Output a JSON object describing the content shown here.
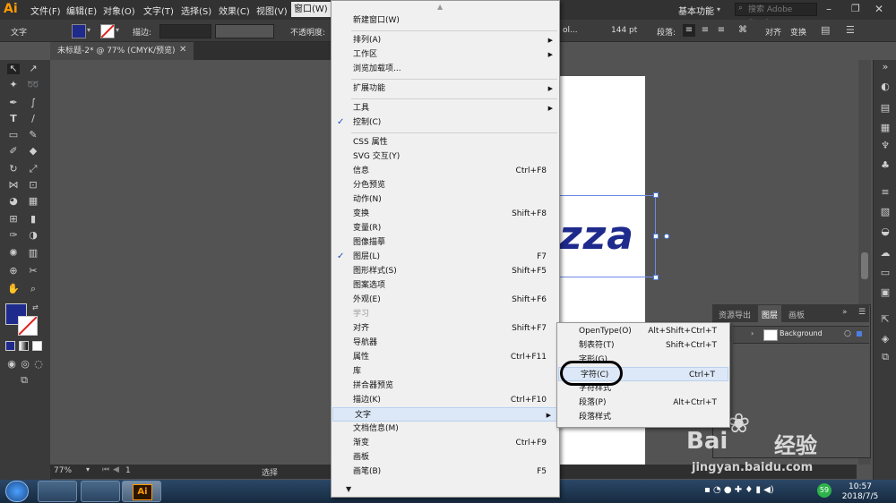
{
  "app": {
    "logo": "Ai"
  },
  "menubar": {
    "items": [
      "文件(F)",
      "编辑(E)",
      "对象(O)",
      "文字(T)",
      "选择(S)",
      "效果(C)",
      "视图(V)",
      "窗口(W)"
    ],
    "workspace": "基本功能",
    "search_placeholder": "搜索 Adobe Stock"
  },
  "controlbar": {
    "label": "文字",
    "stroke_label": "描边:",
    "opacity_label": "不透明度:",
    "font_fragment": "ol...",
    "font_size": "144 pt",
    "paragraph_label": "段落:",
    "align_label": "对齐",
    "transform_label": "变换"
  },
  "document": {
    "tab_title": "未标题-2* @ 77% (CMYK/预览)",
    "text": "zza"
  },
  "statusbar": {
    "zoom": "77%",
    "page": "1",
    "tool": "选择"
  },
  "layers_panel": {
    "tabs": [
      "资源导出",
      "图层",
      "画板"
    ],
    "layer_name": "Background"
  },
  "window_menu": {
    "items": [
      {
        "label": "新建窗口(W)"
      },
      {
        "sep": true
      },
      {
        "label": "排列(A)",
        "submenu": true
      },
      {
        "label": "工作区",
        "submenu": true
      },
      {
        "label": "浏览加载项..."
      },
      {
        "sep": true
      },
      {
        "label": "扩展功能",
        "submenu": true
      },
      {
        "sep": true
      },
      {
        "label": "工具",
        "submenu": true
      },
      {
        "label": "控制(C)",
        "checked": true
      },
      {
        "sep": true
      },
      {
        "label": "CSS 属性"
      },
      {
        "label": "SVG 交互(Y)"
      },
      {
        "label": "信息",
        "shortcut": "Ctrl+F8"
      },
      {
        "label": "分色预览"
      },
      {
        "label": "动作(N)"
      },
      {
        "label": "变换",
        "shortcut": "Shift+F8"
      },
      {
        "label": "变量(R)"
      },
      {
        "label": "图像描摹"
      },
      {
        "label": "图层(L)",
        "shortcut": "F7",
        "checked": true
      },
      {
        "label": "图形样式(S)",
        "shortcut": "Shift+F5"
      },
      {
        "label": "图案选项"
      },
      {
        "label": "外观(E)",
        "shortcut": "Shift+F6"
      },
      {
        "label": "学习",
        "disabled": true
      },
      {
        "label": "对齐",
        "shortcut": "Shift+F7"
      },
      {
        "label": "导航器"
      },
      {
        "label": "属性",
        "shortcut": "Ctrl+F11"
      },
      {
        "label": "库"
      },
      {
        "label": "拼合器预览"
      },
      {
        "label": "描边(K)",
        "shortcut": "Ctrl+F10"
      },
      {
        "label": "文字",
        "submenu": true,
        "highlighted": true
      },
      {
        "label": "文档信息(M)"
      },
      {
        "label": "渐变",
        "shortcut": "Ctrl+F9"
      },
      {
        "label": "画板"
      },
      {
        "label": "画笔(B)",
        "shortcut": "F5"
      }
    ]
  },
  "text_submenu": {
    "items": [
      {
        "label": "OpenType(O)",
        "shortcut": "Alt+Shift+Ctrl+T"
      },
      {
        "label": "制表符(T)",
        "shortcut": "Shift+Ctrl+T"
      },
      {
        "label": "字形(G)"
      },
      {
        "label": "字符(C)",
        "shortcut": "Ctrl+T",
        "highlighted": true
      },
      {
        "label": "字符样式"
      },
      {
        "label": "段落(P)",
        "shortcut": "Alt+Ctrl+T"
      },
      {
        "label": "段落样式"
      }
    ]
  },
  "taskbar": {
    "time": "10:57",
    "date": "2018/7/5",
    "tray_badge": "59"
  },
  "watermark": {
    "brand": "Bai",
    "brand_cn": "经验",
    "url": "jingyan.baidu.com"
  },
  "colors": {
    "fill": "#1e2a8c",
    "menu_bg": "#f0f0f0",
    "highlight": "#dce8f7"
  }
}
